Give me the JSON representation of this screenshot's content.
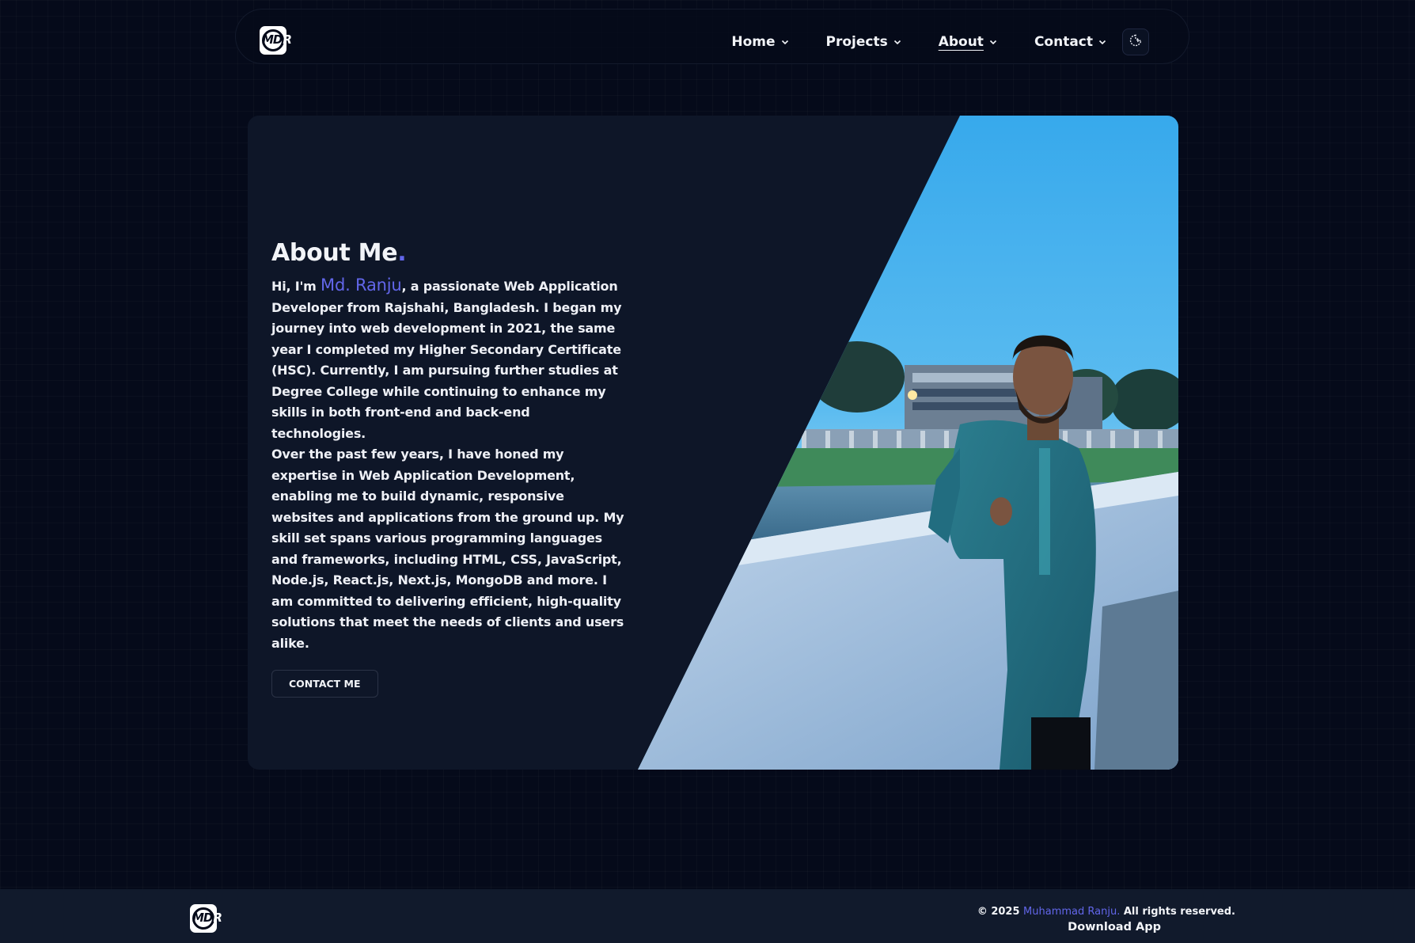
{
  "brand": {
    "logo_text": "MD",
    "logo_text_r": "R"
  },
  "nav": {
    "items": [
      {
        "label": "Home"
      },
      {
        "label": "Projects"
      },
      {
        "label": "About",
        "active": true
      },
      {
        "label": "Contact"
      }
    ],
    "theme_toggle_icon": "moon-sun-icon"
  },
  "about": {
    "title": "About Me",
    "title_dot": ".",
    "intro_prefix": "Hi, I'm ",
    "name": "Md. Ranju",
    "paragraph1_rest": ", a passionate Web Application Developer from Rajshahi, Bangladesh. I began my journey into web development in 2021, the same year I completed my Higher Secondary Certificate (HSC). Currently, I am pursuing further studies at Degree College while continuing to enhance my skills in both front-end and back-end technologies.",
    "paragraph2": "Over the past few years, I have honed my expertise in Web Application Development, enabling me to build dynamic, responsive websites and applications from the ground up. My skill set spans various programming languages and frameworks, including HTML, CSS, JavaScript, Node.js, React.js, Next.js, MongoDB and more. I am committed to delivering efficient, high-quality solutions that meet the needs of clients and users alike.",
    "cta_label": "CONTACT ME"
  },
  "footer": {
    "copyright_prefix": "© 2025 ",
    "copyright_name": "Muhammad Ranju.",
    "copyright_suffix": " All rights reserved.",
    "download_label": "Download App"
  },
  "colors": {
    "background": "#050a1a",
    "card": "#0e1628",
    "accent": "#6266ea",
    "footer": "#111a2c"
  }
}
